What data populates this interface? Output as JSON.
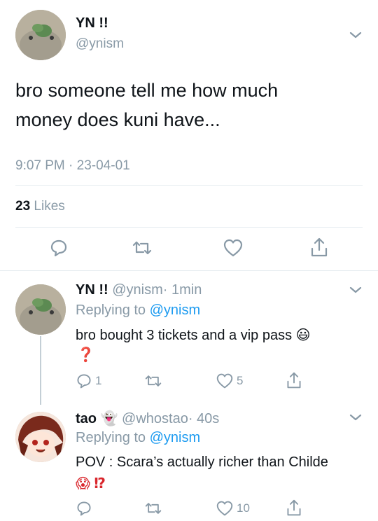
{
  "main_tweet": {
    "display_name": "YN !!",
    "handle": "@ynism",
    "text_line1": "bro someone tell me how much",
    "text_line2": "money does kuni have...",
    "timestamp": "9:07 PM · 23-04-01",
    "likes_count": "23",
    "likes_label": "Likes"
  },
  "replies": [
    {
      "display_name": "YN !!",
      "handle": "@ynism",
      "time": "· 1min",
      "replying_prefix": "Replying to",
      "replying_handle": "@ynism",
      "text_line1": "bro bought 3 tickets and a vip pass",
      "text_line1_emoji": "😃",
      "text_line2": "❓",
      "reply_count": "1",
      "retweet_count": "",
      "like_count": "5"
    },
    {
      "display_name": "tao",
      "display_emoji": "👻",
      "handle": "@whostao",
      "time": "· 40s",
      "replying_prefix": "Replying to",
      "replying_handle": "@ynism",
      "text_line1": "POV : Scara’s actually richer than Childe",
      "text_line2": "😱 ⁉",
      "reply_count": "",
      "retweet_count": "",
      "like_count": "10"
    }
  ],
  "icons": [
    "reply-icon",
    "retweet-icon",
    "like-icon",
    "share-icon",
    "chevron-down-icon"
  ],
  "colors": {
    "link": "#1d9bf0",
    "muted": "#8899a6",
    "text": "#0f1419"
  }
}
